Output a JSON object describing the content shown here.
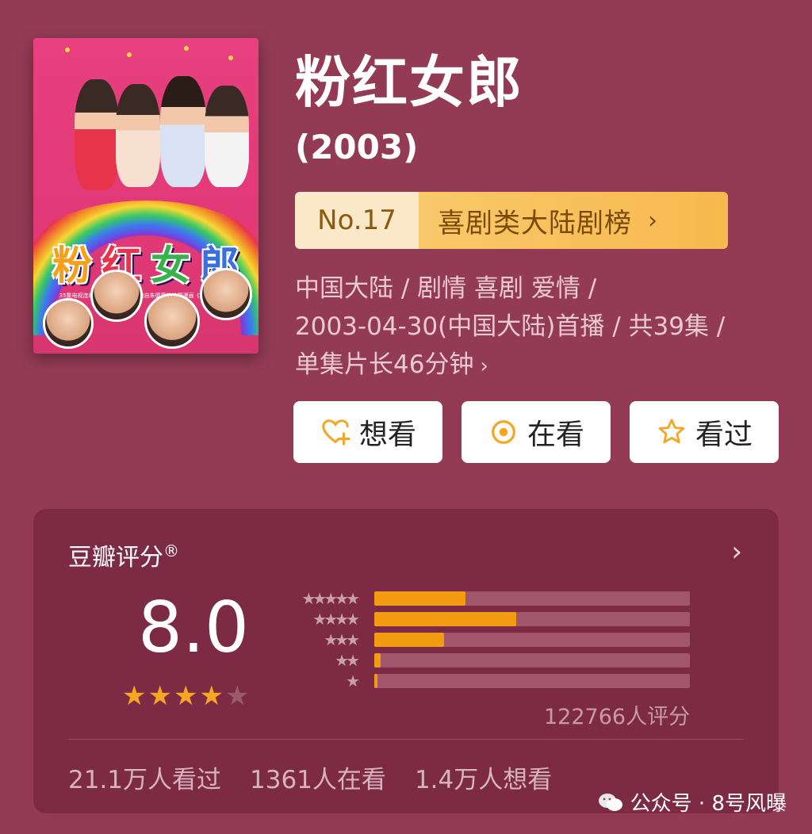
{
  "poster": {
    "title_chars": [
      "粉",
      "红",
      "女",
      "郎"
    ],
    "tagline": "35集电视连续剧《粉红女郎》改编自朱德庸的连载漫画《涩女郎》系列"
  },
  "title": "粉红女郎",
  "year": "(2003)",
  "rank": {
    "number": "No.17",
    "label": "喜剧类大陆剧榜",
    "chevron": "›"
  },
  "meta": {
    "line1": "中国大陆 / 剧情 喜剧 爱情 /",
    "line2": "2003-04-30(中国大陆)首播 / 共39集 /",
    "line3": "单集片长46分钟",
    "chevron": "›"
  },
  "actions": [
    {
      "label": "想看",
      "icon": "heart-plus-icon"
    },
    {
      "label": "在看",
      "icon": "target-circle-icon"
    },
    {
      "label": "看过",
      "icon": "star-outline-icon"
    }
  ],
  "rating": {
    "label": "豆瓣评分",
    "registered": "®",
    "arrow": "›",
    "score": "8.0",
    "stars_filled": 4,
    "stars_total": 5,
    "distribution": [
      {
        "stars": "★★★★★",
        "fraction": 0.29
      },
      {
        "stars": "★★★★",
        "fraction": 0.45
      },
      {
        "stars": "★★★",
        "fraction": 0.22
      },
      {
        "stars": "★★",
        "fraction": 0.02
      },
      {
        "stars": "★",
        "fraction": 0.005
      }
    ],
    "count": "122766人评分",
    "colors": {
      "fill": "#f39c12",
      "track": "#a2566c",
      "star_on": "#f5a623",
      "star_off": "#9a5a6e"
    }
  },
  "stats": {
    "watched": "21.1万人看过",
    "watching": "1361人在看",
    "want": "1.4万人想看"
  },
  "watermark": {
    "text": "公众号 · 8号风曝",
    "icon": "wechat-icon"
  }
}
